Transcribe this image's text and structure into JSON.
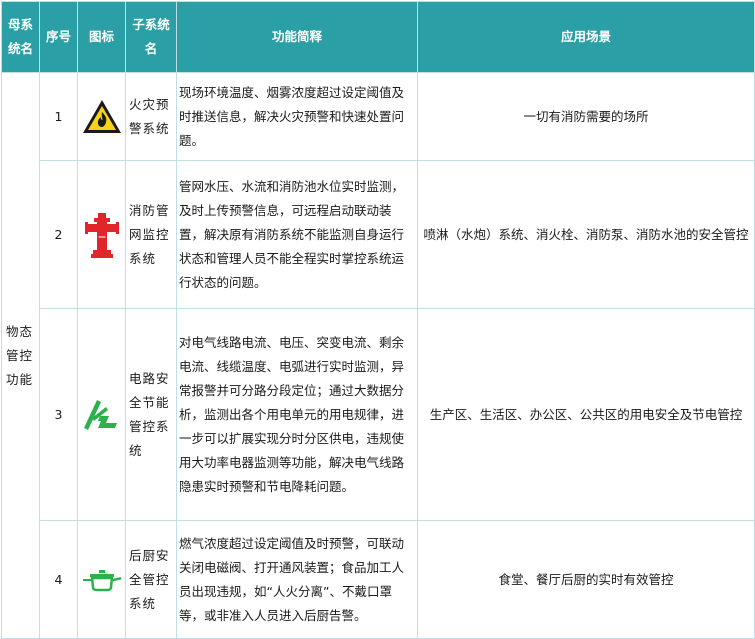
{
  "headers": {
    "mother_system": "母系统名",
    "index": "序号",
    "icon": "图标",
    "subsystem": "子系统名",
    "function": "功能简释",
    "scene": "应用场景"
  },
  "mother_system_name": "物态管控功能",
  "rows": [
    {
      "index": "1",
      "icon": "fire-warning-icon",
      "subsystem": "火灾预警系统",
      "function": "现场环境温度、烟雾浓度超过设定阈值及时推送信息，解决火灾预警和快速处置问题。",
      "scene": "一切有消防需要的场所"
    },
    {
      "index": "2",
      "icon": "fire-hydrant-icon",
      "subsystem": "消防管网监控系统",
      "function": "管网水压、水流和消防池水位实时监测，及时上传预警信息，可远程启动联动装置，解决原有消防系统不能监测自身运行状态和管理人员不能全程实时掌控系统运行状态的问题。",
      "scene": "喷淋（水炮）系统、消火栓、消防泵、消防水池的安全管控"
    },
    {
      "index": "3",
      "icon": "electric-energy-saving-icon",
      "subsystem": "电路安全节能管控系统",
      "function": "对电气线路电流、电压、突变电流、剩余电流、线缆温度、电弧进行实时监测，异常报警并可分路分段定位；通过大数据分析，监测出各个用电单元的用电规律，进一步可以扩展实现分时分区供电，违规使用大功率电器监测等功能，解决电气线路隐患实时预警和节电降耗问题。",
      "scene": "生产区、生活区、办公区、公共区的用电安全及节电管控"
    },
    {
      "index": "4",
      "icon": "cooking-pot-icon",
      "subsystem": "后厨安全管控系统",
      "function": "燃气浓度超过设定阈值及时预警，可联动关闭电磁阀、打开通风装置；食品加工人员出现违规，如“人火分离”、不戴口罩等，或非准入人员进入后厨告警。",
      "scene": "食堂、餐厅后厨的实时有效管控"
    }
  ],
  "colors": {
    "header_bg": "#2aa0a6",
    "border": "#bfe0e3",
    "icon_green": "#2bb24c",
    "icon_red": "#e0262b",
    "icon_yellow": "#f7d21b"
  }
}
